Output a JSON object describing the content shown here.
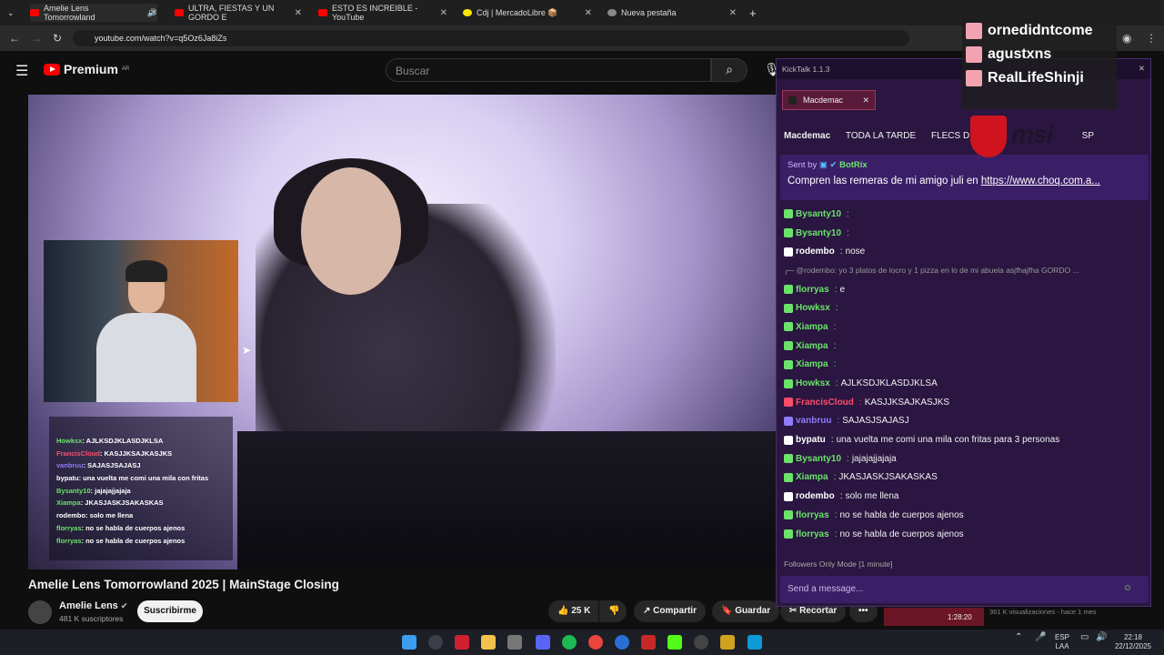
{
  "browser": {
    "tabs": [
      {
        "label": "Amelie Lens Tomorrowland",
        "color": "#ff0000"
      },
      {
        "label": "ULTRA, FIESTAS Y UN GORDO E",
        "color": "#ff0000"
      },
      {
        "label": "ESTO ES INCREIBLE - YouTube",
        "color": "#ff0000"
      },
      {
        "label": "Cdj | MercadoLibre 📦",
        "color": "#ffe600"
      },
      {
        "label": "Nueva pestaña",
        "color": "#888888"
      }
    ],
    "url": "youtube.com/watch?v=q5Oz6Ja8iZs"
  },
  "youtube": {
    "logo": "Premium",
    "region": "AR",
    "search_placeholder": "Buscar",
    "video_title": "Amelie Lens Tomorrowland 2025 | MainStage Closing",
    "channel": "Amelie Lens",
    "subscribers": "481 K suscriptores",
    "subscribe": "Suscribirme",
    "likes": "25 K",
    "share": "Compartir",
    "save": "Guardar",
    "clip": "Recortar",
    "more": "•••"
  },
  "video_overlay_chat": [
    {
      "user": "Howksx",
      "msg": ": AJLKSDJKLASDJKLSA"
    },
    {
      "user": "FrancisCloud",
      "msg": ": KASJJKSAJKASJKS"
    },
    {
      "user": "vanbruu",
      "msg": ": SAJASJSAJASJ"
    },
    {
      "user": "bypatu",
      "msg": ": una vuelta me comi una mila con fritas"
    },
    {
      "user": "Bysanty10",
      "msg": ": jajajajjajaja"
    },
    {
      "user": "Xiampa",
      "msg": ": JKASJASKJSAKASKAS"
    },
    {
      "user": "rodembo",
      "msg": ": solo me llena"
    },
    {
      "user": "florryas",
      "msg": ": no se habla de cuerpos ajenos"
    },
    {
      "user": "florryas",
      "msg": ": no se habla de cuerpos ajenos"
    }
  ],
  "kicktalk": {
    "app": "KickTalk 1.1.3",
    "tab": "Macdemac",
    "channels": [
      "Macdemac",
      "TODA LA TARDE",
      "FLECS DE",
      "SP"
    ],
    "pinned_by": "Sent by",
    "pinned_user": "BotRix",
    "pinned_text": "Compren las remeras de mi amigo juli en ",
    "pinned_link": "https://www.choq.com.a...",
    "messages": [
      {
        "user": "Bysanty10",
        "color": "#6be36b",
        "text": ""
      },
      {
        "user": "Bysanty10",
        "color": "#6be36b",
        "text": ""
      },
      {
        "user": "rodembo",
        "color": "#ffffff",
        "text": "nose"
      },
      {
        "user": "",
        "color": "#999999",
        "text": "╭─ @rodembo: yo 3 platos de locro y 1 pizza en lo de mi abuela asjfhajfha GORDO ..."
      },
      {
        "user": "florryas",
        "color": "#6be36b",
        "text": "e"
      },
      {
        "user": "Howksx",
        "color": "#6be36b",
        "text": ""
      },
      {
        "user": "Xiampa",
        "color": "#6be36b",
        "text": ""
      },
      {
        "user": "Xiampa",
        "color": "#6be36b",
        "text": ""
      },
      {
        "user": "Xiampa",
        "color": "#6be36b",
        "text": ""
      },
      {
        "user": "Howksx",
        "color": "#6be36b",
        "text": "AJLKSDJKLASDJKLSA"
      },
      {
        "user": "FrancisCloud",
        "color": "#ff4d6a",
        "text": "KASJJKSAJKASJKS"
      },
      {
        "user": "vanbruu",
        "color": "#8f7bff",
        "text": "SAJASJSAJASJ"
      },
      {
        "user": "bypatu",
        "color": "#ffffff",
        "text": "una vuelta me comi una mila con fritas para 3 personas"
      },
      {
        "user": "Bysanty10",
        "color": "#6be36b",
        "text": "jajajajjajaja"
      },
      {
        "user": "Xiampa",
        "color": "#6be36b",
        "text": "JKASJASKJSAKASKAS"
      },
      {
        "user": "rodembo",
        "color": "#ffffff",
        "text": "solo me llena"
      },
      {
        "user": "florryas",
        "color": "#6be36b",
        "text": "no se habla de cuerpos ajenos"
      },
      {
        "user": "florryas",
        "color": "#6be36b",
        "text": "no se habla de cuerpos ajenos"
      }
    ],
    "mode": "Followers Only Mode [1 minute]",
    "input_placeholder": "Send a message..."
  },
  "gifts": [
    "ornedidntcome",
    "agustxns",
    "RealLifeShinji"
  ],
  "msi": "msi",
  "thumbnail": {
    "time": "1:28:20",
    "views": "361 K visualizaciones - hace 1 mes"
  },
  "taskbar": {
    "lang": "ESP",
    "region": "LAA",
    "time": "22:18",
    "date": "22/12/2025"
  }
}
